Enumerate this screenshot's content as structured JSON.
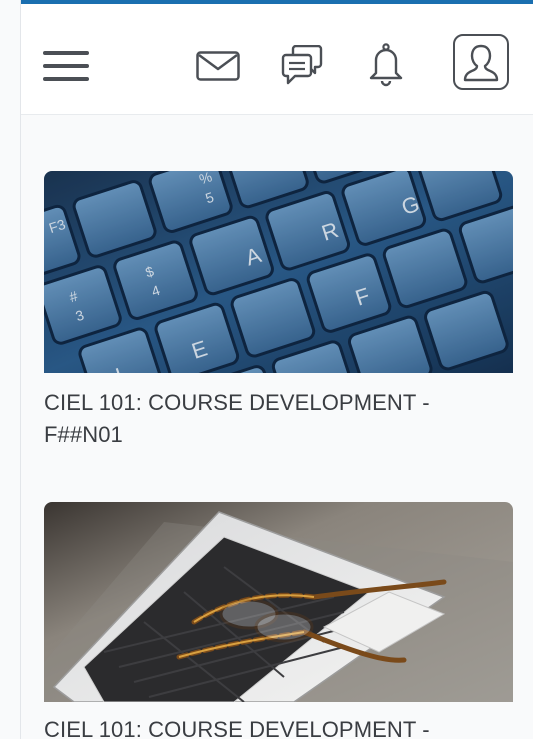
{
  "header": {
    "menu_icon": "hamburger-menu-icon",
    "mail_icon": "envelope-icon",
    "chat_icon": "chat-bubbles-icon",
    "notification_icon": "bell-icon",
    "profile_icon": "user-avatar-icon"
  },
  "colors": {
    "accent": "#1a6fb0",
    "icon": "#4b4f55",
    "text": "#3a3d42"
  },
  "courses": [
    {
      "title_line1": "CIEL 101: COURSE DEVELOPMENT -",
      "title_line2": "F##N01",
      "image": "keyboard-learn-keys-image"
    },
    {
      "title_line1": "CIEL 101: COURSE DEVELOPMENT -",
      "image": "laptop-with-glasses-image"
    }
  ]
}
